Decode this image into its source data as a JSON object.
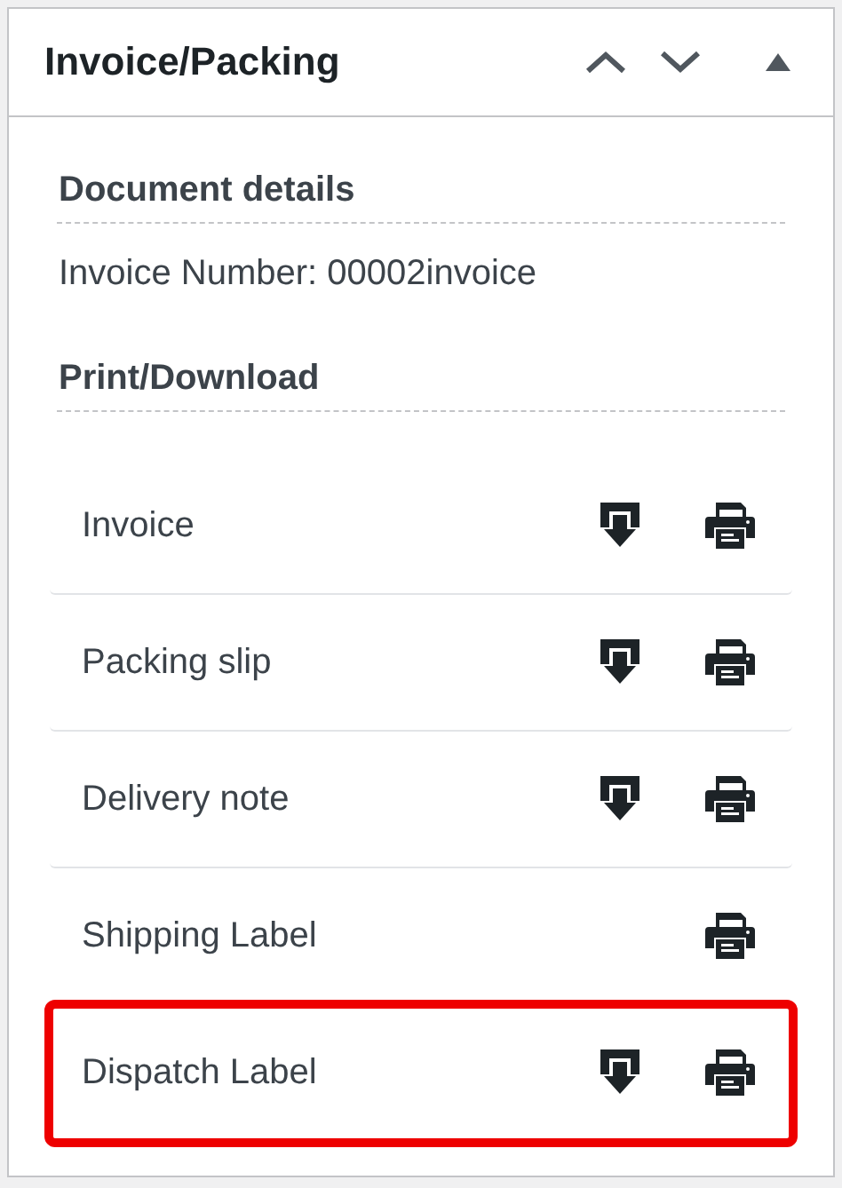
{
  "panel": {
    "title": "Invoice/Packing"
  },
  "document_details": {
    "heading": "Document details",
    "invoice_number": "Invoice Number: 00002invoice"
  },
  "print_download": {
    "heading": "Print/Download",
    "rows": [
      {
        "label": "Invoice",
        "download": true,
        "print": true,
        "highlighted": false
      },
      {
        "label": "Packing slip",
        "download": true,
        "print": true,
        "highlighted": false
      },
      {
        "label": "Delivery note",
        "download": true,
        "print": true,
        "highlighted": false
      },
      {
        "label": "Shipping Label",
        "download": false,
        "print": true,
        "highlighted": false
      },
      {
        "label": "Dispatch Label",
        "download": true,
        "print": true,
        "highlighted": true
      }
    ]
  }
}
